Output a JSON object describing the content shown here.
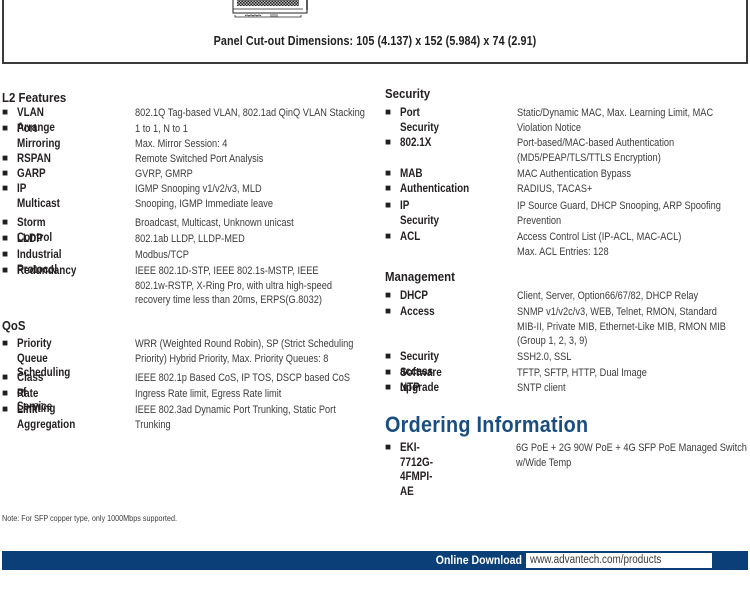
{
  "panel": {
    "caption": "Panel Cut-out Dimensions: 105 (4.137) x 152 (5.984) x 74 (2.91)"
  },
  "l2_features": {
    "title": "L2 Features",
    "items": [
      {
        "name": "VLAN Arrange",
        "desc": "802.1Q Tag-based VLAN, 802.1ad QinQ VLAN Stacking"
      },
      {
        "name": "Port Mirroring",
        "desc": "1 to 1, N to 1\nMax. Mirror Session: 4"
      },
      {
        "name": "RSPAN",
        "desc": "Remote Switched Port Analysis"
      },
      {
        "name": "GARP",
        "desc": "GVRP, GMRP"
      },
      {
        "name": "IP Multicast",
        "desc": "IGMP Snooping v1/v2/v3, MLD\nSnooping, IGMP Immediate leave"
      },
      {
        "name": "Storm Control",
        "desc": "Broadcast, Multicast, Unknown unicast"
      },
      {
        "name": "LLDP",
        "desc": "802.1ab LLDP, LLDP-MED"
      },
      {
        "name": "Industrial Protocol",
        "desc": "Modbus/TCP"
      },
      {
        "name": "Redundancy",
        "desc": "IEEE 802.1D-STP, IEEE 802.1s-MSTP, IEEE\n802.1w-RSTP, X-Ring Pro, with ultra high-speed\nrecovery time less than 20ms, ERPS(G.8032)"
      }
    ]
  },
  "qos": {
    "title": "QoS",
    "items": [
      {
        "name": "Priority Queue\nScheduling",
        "desc": "WRR (Weighted Round Robin), SP (Strict Scheduling\nPriority) Hybrid Priority, Max. Priority Queues: 8"
      },
      {
        "name": "Class of Service",
        "desc": "IEEE 802.1p Based CoS, IP TOS, DSCP based CoS"
      },
      {
        "name": "Rate Limiting",
        "desc": "Ingress Rate limit, Egress Rate limit"
      },
      {
        "name": "Link Aggregation",
        "desc": "IEEE 802.3ad Dynamic Port Trunking, Static Port\nTrunking"
      }
    ]
  },
  "security": {
    "title": "Security",
    "items": [
      {
        "name": "Port Security",
        "desc": "Static/Dynamic MAC, Max. Learning Limit, MAC\nViolation Notice"
      },
      {
        "name": "802.1X",
        "desc": "Port-based/MAC-based Authentication\n(MD5/PEAP/TLS/TTLS Encryption)"
      },
      {
        "name": "MAB",
        "desc": "MAC Authentication Bypass"
      },
      {
        "name": "Authentication",
        "desc": "RADIUS, TACAS+"
      },
      {
        "name": "IP Security",
        "desc": "IP Source Guard, DHCP Snooping, ARP Spoofing\nPrevention"
      },
      {
        "name": "ACL",
        "desc": "Access Control List (IP-ACL, MAC-ACL)\nMax. ACL Entries: 128"
      }
    ]
  },
  "management": {
    "title": "Management",
    "items": [
      {
        "name": "DHCP",
        "desc": "Client, Server, Option66/67/82, DHCP Relay"
      },
      {
        "name": "Access",
        "desc": "SNMP v1/v2c/v3, WEB, Telnet, RMON, Standard\nMIB-II, Private MIB, Ethernet-Like MIB, RMON MIB\n(Group 1, 2, 3, 9)"
      },
      {
        "name": "Security access",
        "desc": "SSH2.0, SSL"
      },
      {
        "name": "Software upgrade",
        "desc": "TFTP, SFTP, HTTP, Dual Image"
      },
      {
        "name": "NTP",
        "desc": "SNTP client"
      }
    ]
  },
  "ordering": {
    "title": "Ordering Information",
    "items": [
      {
        "name": "EKI-7712G-4FMPI-AE",
        "desc": "6G PoE + 2G 90W PoE + 4G SFP PoE Managed Switch\nw/Wide Temp"
      }
    ]
  },
  "note": "Note: For SFP copper type, only 1000Mbps supported.",
  "footer": {
    "label": "Online Download",
    "url": "www.advantech.com/products"
  }
}
